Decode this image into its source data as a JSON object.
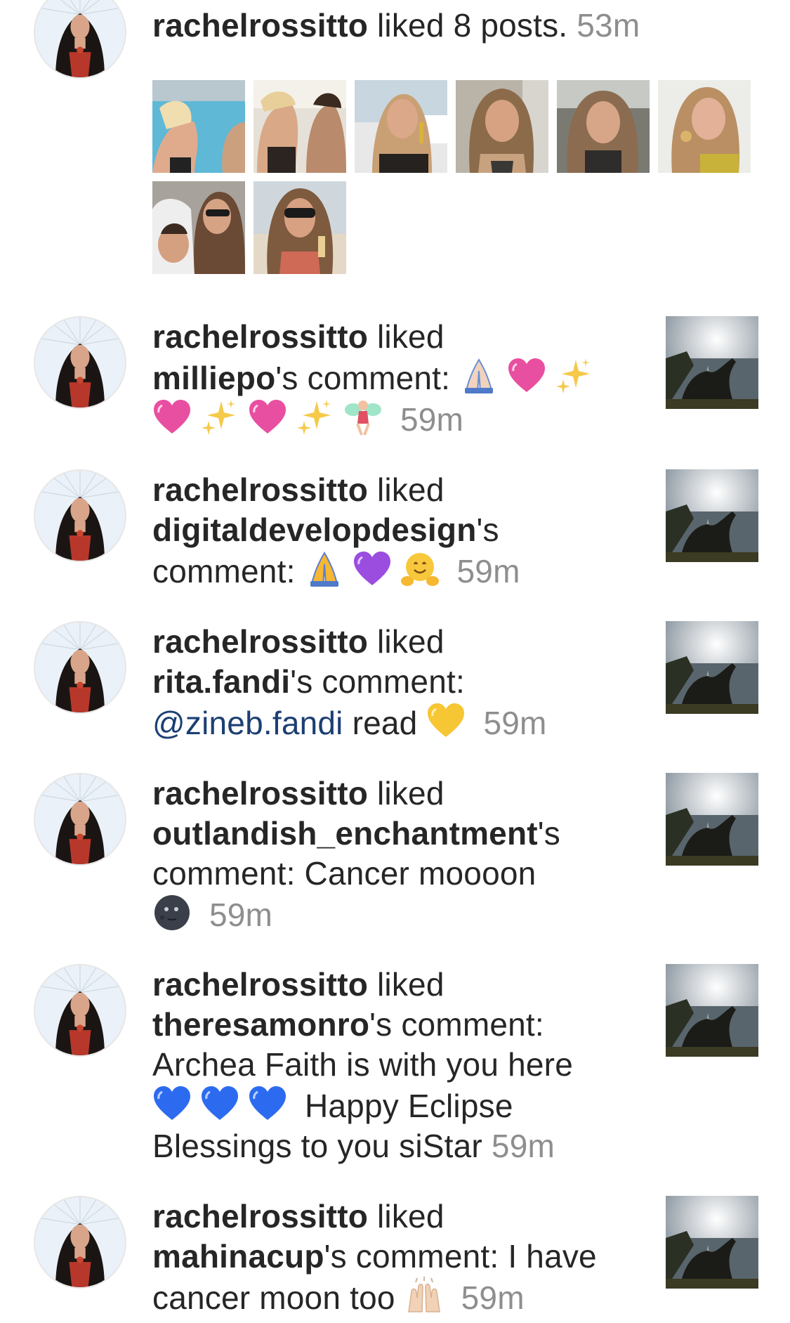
{
  "activity": {
    "group": {
      "user": "rachelrossitto",
      "action": "liked 8 posts.",
      "time": "53m",
      "posts": [
        {
          "icon": "post-thumbnail-pool"
        },
        {
          "icon": "post-thumbnail-beach-couple"
        },
        {
          "icon": "post-thumbnail-selfie-coast"
        },
        {
          "icon": "post-thumbnail-selfie-bob"
        },
        {
          "icon": "post-thumbnail-selfie-car"
        },
        {
          "icon": "post-thumbnail-selfie-lips"
        },
        {
          "icon": "post-thumbnail-child-hood"
        },
        {
          "icon": "post-thumbnail-sunglasses"
        }
      ]
    },
    "items": [
      {
        "user": "rachelrossitto",
        "action": "liked",
        "commenter": "milliepo",
        "suffix": "'s comment:",
        "comment": "",
        "emojis": [
          "folded-hands-light",
          "pink-heart",
          "sparkles",
          "pink-heart",
          "sparkles",
          "pink-heart",
          "sparkles",
          "fairy"
        ],
        "time": "59m"
      },
      {
        "user": "rachelrossitto",
        "action": "liked",
        "commenter": "digitaldevelopdesign",
        "suffix": "'s",
        "comment": "comment:",
        "emojis": [
          "folded-hands",
          "purple-heart",
          "hugging-face"
        ],
        "time": "59m"
      },
      {
        "user": "rachelrossitto",
        "action": "liked",
        "commenter": "rita.fandi",
        "suffix": "'s comment:",
        "mention": "@zineb.fandi",
        "comment": "read",
        "emojis": [
          "yellow-heart"
        ],
        "time": "59m"
      },
      {
        "user": "rachelrossitto",
        "action": "liked",
        "commenter": "outlandish_enchantment",
        "suffix": "'s",
        "comment": "comment: Cancer moooon",
        "emojis": [
          "new-moon-face"
        ],
        "time": "59m"
      },
      {
        "user": "rachelrossitto",
        "action": "liked",
        "commenter": "theresamonro",
        "suffix": "'s comment:",
        "comment": "Archea Faith is with you here",
        "emojis": [
          "blue-heart",
          "blue-heart",
          "blue-heart"
        ],
        "comment2": "Happy Eclipse Blessings to you siStar",
        "time": "59m"
      },
      {
        "user": "rachelrossitto",
        "action": "liked",
        "commenter": "mahinacup",
        "suffix": "'s comment: I have",
        "comment": "cancer moon too",
        "emojis": [
          "raising-hands"
        ],
        "time": "59m"
      }
    ]
  },
  "colors": {
    "text": "#262626",
    "username": "#262626",
    "timestamp": "#8e8e8e",
    "mention": "#1c3f73",
    "background": "#ffffff"
  }
}
